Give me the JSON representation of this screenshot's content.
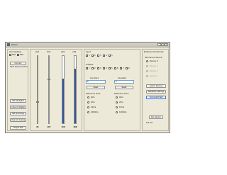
{
  "window": {
    "title": "Demo",
    "controls": [
      "minimize-icon",
      "maximize-icon",
      "close-icon"
    ]
  },
  "left": {
    "card_address_label": "Card Address",
    "sk5": "SK5",
    "sk6": "SK6",
    "sk5_checked": true,
    "sk6_checked": true,
    "connect": "Connect",
    "status": "Card Disconnected",
    "set_all_digital": "Set All Digital",
    "clear_all_digital": "Clear All Digital",
    "set_all_analog": "Set All Analog",
    "clear_all_analog": "Clear All Analog",
    "output_test": "Output Test"
  },
  "sliders": {
    "labels": [
      "DA1",
      "DA2"
    ],
    "values": [
      "81",
      "167"
    ],
    "fraction": [
      0.32,
      0.65
    ]
  },
  "inputs_meters": {
    "labels": [
      "AD1",
      "AD2"
    ],
    "values": [
      "169",
      "208"
    ],
    "fraction": [
      0.66,
      0.81
    ]
  },
  "input_section": {
    "label": "Input",
    "checkbox_labels": [
      "1",
      "2",
      "3",
      "4",
      "5"
    ],
    "outputs_label": "Outputs",
    "output_labels": [
      "1",
      "2",
      "3",
      "4",
      "5",
      "6",
      "7",
      "8"
    ]
  },
  "counters": [
    {
      "label": "Counter1",
      "value": "0",
      "reset": "Reset",
      "debounce_label": "Debounce Time",
      "options": [
        "0ms",
        "2ms",
        "10ms",
        "1000ms"
      ],
      "selected": 1
    },
    {
      "label": "Counter2",
      "value": "0",
      "reset": "Reset",
      "debounce_label": "Debounce Time",
      "options": [
        "0ms",
        "2ms",
        "10ms",
        "1000ms"
      ],
      "selected": 1
    }
  ],
  "multicard": {
    "title": "Multicard Commands",
    "set_current_label": "Set Current Device",
    "devices": [
      "Device 0",
      "Device 1",
      "Device 2",
      "Device 3"
    ],
    "selected": 0,
    "search_devices": "Search Devices",
    "readback_settings": "Readback Settings",
    "connected_test": "Connected Test",
    "dll_version": "DLL Version",
    "version_value": "0.0.0.0"
  }
}
